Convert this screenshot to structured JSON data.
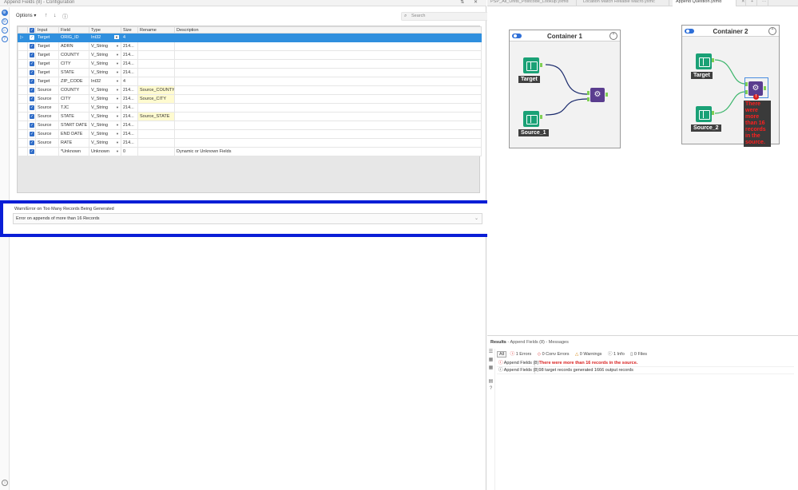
{
  "config": {
    "title": "Append Fields (8) - Configuration",
    "options_label": "Options",
    "search_placeholder": "Search",
    "columns": [
      "",
      "",
      "Input",
      "Field",
      "Type",
      "Size",
      "Rename",
      "Description"
    ],
    "rows": [
      {
        "input": "Target",
        "field": "ORIG_ID",
        "type": "Int32",
        "size": "4",
        "rename": "",
        "description": "",
        "selected": true
      },
      {
        "input": "Target",
        "field": "ADRN",
        "type": "V_String",
        "size": "214...",
        "rename": "",
        "description": ""
      },
      {
        "input": "Target",
        "field": "COUNTY",
        "type": "V_String",
        "size": "214...",
        "rename": "",
        "description": ""
      },
      {
        "input": "Target",
        "field": "CITY",
        "type": "V_String",
        "size": "214...",
        "rename": "",
        "description": ""
      },
      {
        "input": "Target",
        "field": "STATE",
        "type": "V_String",
        "size": "214...",
        "rename": "",
        "description": ""
      },
      {
        "input": "Target",
        "field": "ZIP_CODE",
        "type": "Int32",
        "size": "4",
        "rename": "",
        "description": ""
      },
      {
        "input": "Source",
        "field": "COUNTY",
        "type": "V_String",
        "size": "214...",
        "rename": "Source_COUNTY",
        "description": ""
      },
      {
        "input": "Source",
        "field": "CITY",
        "type": "V_String",
        "size": "214...",
        "rename": "Source_CITY",
        "description": ""
      },
      {
        "input": "Source",
        "field": "TJC",
        "type": "V_String",
        "size": "214...",
        "rename": "",
        "description": ""
      },
      {
        "input": "Source",
        "field": "STATE",
        "type": "V_String",
        "size": "214...",
        "rename": "Source_STATE",
        "description": ""
      },
      {
        "input": "Source",
        "field": "START DATE",
        "type": "V_String",
        "size": "214...",
        "rename": "",
        "description": ""
      },
      {
        "input": "Source",
        "field": "END DATE",
        "type": "V_String",
        "size": "214...",
        "rename": "",
        "description": ""
      },
      {
        "input": "Source",
        "field": "RATE",
        "type": "V_String",
        "size": "214...",
        "rename": "",
        "description": ""
      },
      {
        "input": "",
        "field": "*Unknown",
        "type": "Unknown",
        "size": "0",
        "rename": "",
        "description": "Dynamic or Unknown Fields"
      }
    ],
    "warn_label": "Warn/Error on Too Many Records Being Generated",
    "warn_value": "Error on appends of more than 16 Records"
  },
  "canvas": {
    "tabs": [
      "PSP_All_Units_Postcode_Lookup.yxmd",
      "Location Match Reliable Macro.yxmc",
      "Append Question.yxmd"
    ],
    "container1": {
      "title": "Container 1",
      "target_label": "Target",
      "source_label": "Source_1"
    },
    "container2": {
      "title": "Container 2",
      "target_label": "Target",
      "source_label": "Source_2",
      "error_text": "There were more than 16 records in the source."
    }
  },
  "results": {
    "title": "Results",
    "subtitle": "- Append Fields (8) - Messages",
    "filter_all": "All",
    "errors": "1 Errors",
    "conv_errors": "0 Conv Errors",
    "warnings": "0 Warnings",
    "info": "1 Info",
    "files": "0 Files",
    "messages": [
      {
        "tool": "Append Fields (8)",
        "text": "There were more than 16 records in the source.",
        "level": "error"
      },
      {
        "tool": "Append Fields (8)",
        "text": "98 target records generated 1666 output records",
        "level": "info"
      }
    ]
  }
}
